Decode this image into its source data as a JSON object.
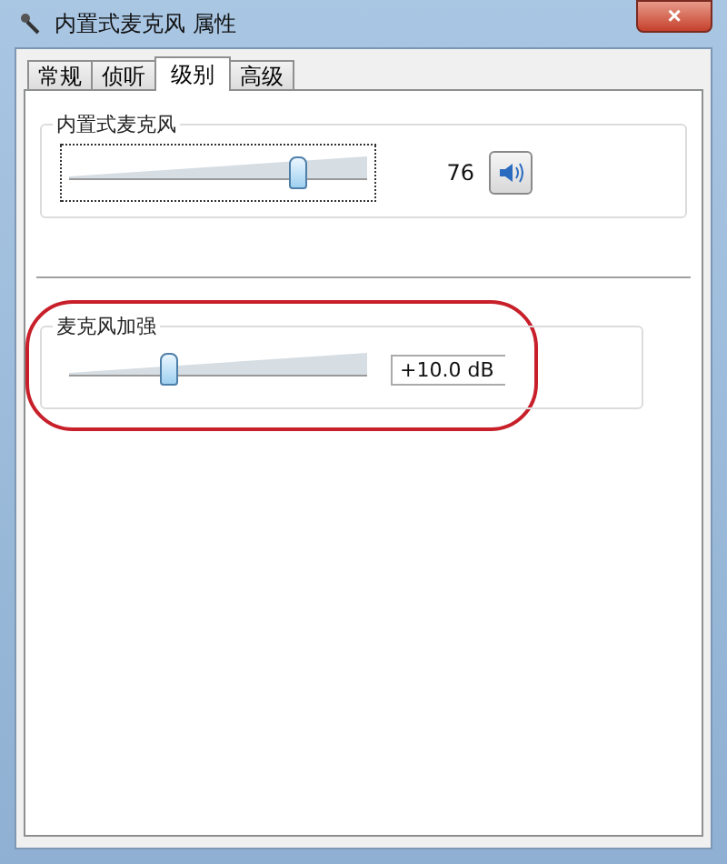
{
  "window": {
    "title": "内置式麦克风 属性",
    "close": "×"
  },
  "tabs": [
    {
      "label": "常规",
      "selected": false
    },
    {
      "label": "侦听",
      "selected": false
    },
    {
      "label": "级别",
      "selected": true
    },
    {
      "label": "高级",
      "selected": false
    }
  ],
  "groups": [
    {
      "title": "内置式麦克风",
      "level": 0.76,
      "reading": "76",
      "kind": "volume",
      "muted": false,
      "highlighted": false
    },
    {
      "title": "麦克风加强",
      "level": 0.33,
      "reading": "+10.0 dB",
      "kind": "boost",
      "highlighted": true
    }
  ]
}
